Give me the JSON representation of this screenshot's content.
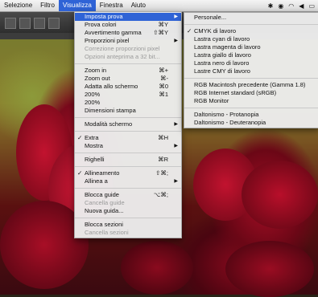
{
  "menubar": {
    "items": [
      "Selezione",
      "Filtro",
      "Visualizza",
      "Finestra",
      "Aiuto"
    ],
    "active_index": 2
  },
  "main_menu": {
    "items": [
      {
        "label": "Imposta prova",
        "submenu": true,
        "highlight": true
      },
      {
        "label": "Prova colori",
        "shortcut": "⌘Y"
      },
      {
        "label": "Avvertimento gamma",
        "shortcut": "⇧⌘Y"
      },
      {
        "label": "Proporzioni pixel",
        "submenu": true
      },
      {
        "label": "Correzione proporzioni pixel",
        "disabled": true
      },
      {
        "label": "Opzioni anteprima a 32 bit...",
        "disabled": true
      },
      {
        "sep": true
      },
      {
        "label": "Zoom in",
        "shortcut": "⌘+"
      },
      {
        "label": "Zoom out",
        "shortcut": "⌘-"
      },
      {
        "label": "Adatta allo schermo",
        "shortcut": "⌘0"
      },
      {
        "label": "200%",
        "shortcut": "⌘1"
      },
      {
        "label": "200%"
      },
      {
        "label": "Dimensioni stampa"
      },
      {
        "sep": true
      },
      {
        "label": "Modalità schermo",
        "submenu": true
      },
      {
        "sep": true
      },
      {
        "label": "Extra",
        "shortcut": "⌘H",
        "checked": true
      },
      {
        "label": "Mostra",
        "submenu": true
      },
      {
        "sep": true
      },
      {
        "label": "Righelli",
        "shortcut": "⌘R"
      },
      {
        "sep": true
      },
      {
        "label": "Allineamento",
        "shortcut": "⇧⌘;",
        "checked": true
      },
      {
        "label": "Allinea a",
        "submenu": true
      },
      {
        "sep": true
      },
      {
        "label": "Blocca guide",
        "shortcut": "⌥⌘;"
      },
      {
        "label": "Cancella guide",
        "disabled": true
      },
      {
        "label": "Nuova guida..."
      },
      {
        "sep": true
      },
      {
        "label": "Blocca sezioni"
      },
      {
        "label": "Cancella sezioni",
        "disabled": true
      }
    ]
  },
  "sub_menu": {
    "items": [
      {
        "label": "Personale..."
      },
      {
        "sep": true
      },
      {
        "label": "CMYK di lavoro",
        "checked": true
      },
      {
        "label": "Lastra cyan di lavoro"
      },
      {
        "label": "Lastra magenta di lavoro"
      },
      {
        "label": "Lastra giallo di lavoro"
      },
      {
        "label": "Lastra nero di lavoro"
      },
      {
        "label": "Lastre CMY di lavoro"
      },
      {
        "sep": true
      },
      {
        "label": "RGB Macintosh precedente (Gamma 1.8)"
      },
      {
        "label": "RGB Internet standard (sRGB)"
      },
      {
        "label": "RGB Monitor"
      },
      {
        "sep": true
      },
      {
        "label": "Daltonismo - Protanopia"
      },
      {
        "label": "Daltonismo - Deuteranopia"
      }
    ]
  },
  "colors": {
    "highlight": "#2f63d6",
    "menu_bg": "#ececec"
  }
}
